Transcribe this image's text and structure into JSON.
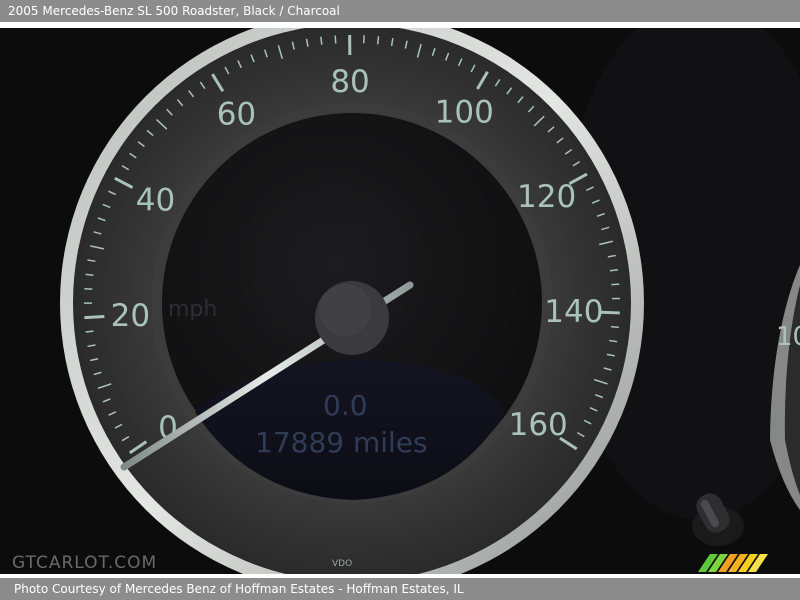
{
  "header": {
    "vehicle": "2005 Mercedes-Benz SL 500 Roadster,",
    "colors": "Black / Charcoal"
  },
  "gauge": {
    "speed_labels": [
      "0",
      "20",
      "40",
      "60",
      "80",
      "100",
      "120",
      "140",
      "160"
    ],
    "side_gauge_label": "10",
    "faded_unit": "mph",
    "odometer_trip": "0.0",
    "odometer_total": "17889 miles",
    "maker_mark": "VDO",
    "scale_color": "#a9c3b9",
    "bezel_color": "#c9cdca"
  },
  "watermark": "GTCARLOT.COM",
  "footer": {
    "caption": "Photo Courtesy of Mercedes Benz of Hoffman Estates - Hoffman Estates, IL"
  },
  "logo": {
    "colors": [
      "#5cc83a",
      "#f0a020",
      "#f5d020"
    ]
  }
}
